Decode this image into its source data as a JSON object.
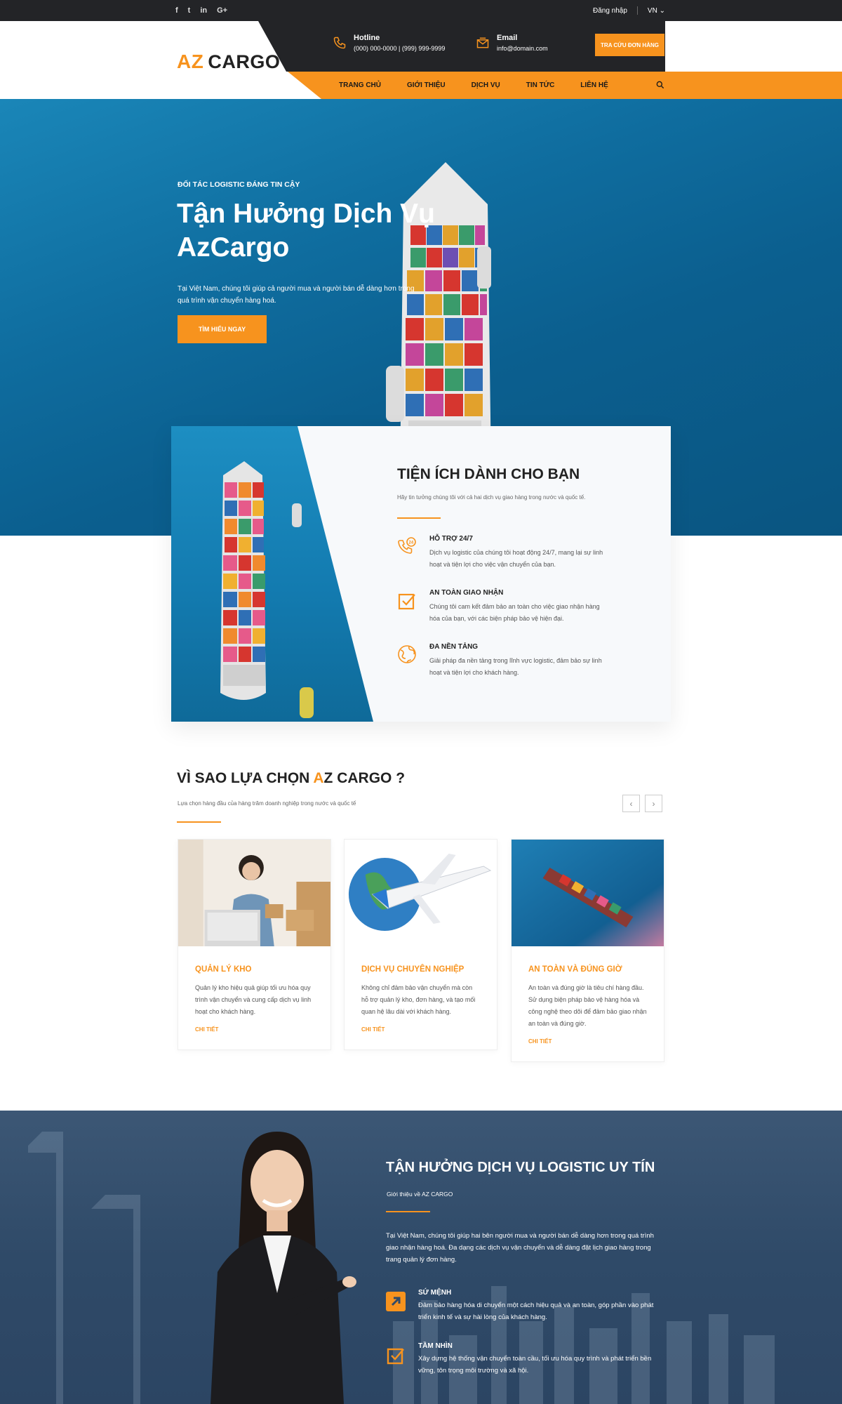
{
  "topbar": {
    "social": [
      {
        "icon": "facebook-icon",
        "glyph": "f"
      },
      {
        "icon": "twitter-icon",
        "glyph": "t"
      },
      {
        "icon": "linkedin-icon",
        "glyph": "in"
      },
      {
        "icon": "googleplus-icon",
        "glyph": "G+"
      }
    ],
    "login": "Đăng nhập",
    "language": "VN"
  },
  "header": {
    "logo_az": "AZ",
    "logo_cargo": "CARGO",
    "hotline_label": "Hotline",
    "hotline_value": "(000) 000-0000 | (999) 999-9999",
    "email_label": "Email",
    "email_value": "info@domain.com",
    "track_button": "TRA CỨU ĐƠN HÀNG",
    "nav": [
      "TRANG CHỦ",
      "GIỚI THIỆU",
      "DỊCH VỤ",
      "TIN TỨC",
      "LIÊN HỆ"
    ]
  },
  "hero": {
    "kicker": "ĐỐI TÁC LOGISTIC ĐÁNG TIN CẬY",
    "title": "Tận Hưởng Dịch Vụ AzCargo",
    "description": "Tại Việt Nam, chúng tôi giúp cả người mua và người bán dễ dàng hơn trong quá trình vận chuyển hàng hoá.",
    "button": "TÌM HIỂU NGAY"
  },
  "benefits": {
    "title": "TIỆN ÍCH DÀNH CHO BẠN",
    "subtitle": "Hãy tin tưởng chúng tôi với cả hai dịch vụ giao hàng trong nước và quốc tế.",
    "items": [
      {
        "icon": "phone-24-icon",
        "title": "HỖ TRỢ 24/7",
        "desc": "Dịch vụ logistic của chúng tôi hoạt động 24/7, mang lại sự linh hoạt và tiện lợi cho việc vận chuyển của bạn."
      },
      {
        "icon": "checkbox-icon",
        "title": "AN TOÀN GIAO NHẬN",
        "desc": "Chúng tôi cam kết đảm bảo an toàn cho việc giao nhận hàng hóa của bạn, với các biện pháp bảo vệ hiện đại."
      },
      {
        "icon": "globe-icon",
        "title": "ĐA NỀN TẢNG",
        "desc": "Giải pháp đa nền tảng trong lĩnh vực logistic, đảm bảo sự linh hoạt và tiện lợi cho khách hàng."
      }
    ]
  },
  "why": {
    "title_before": "VÌ SAO LỰA CHỌN ",
    "title_accent": "A",
    "title_after": "Z CARGO ?",
    "subtitle": "Lựa chọn hàng đầu của hàng trăm doanh nghiệp trong nước và quốc tế",
    "prev": "‹",
    "next": "›",
    "cards": [
      {
        "title": "QUẢN LÝ KHO",
        "desc": "Quản lý kho hiệu quả giúp tối ưu hóa quy trình vận chuyển và cung cấp dịch vụ linh hoạt cho khách hàng.",
        "link": "CHI TIẾT"
      },
      {
        "title": "DỊCH VỤ CHUYÊN NGHIỆP",
        "desc": "Không chỉ đảm bảo vận chuyển mà còn hỗ trợ quản lý kho, đơn hàng, và tạo mối quan hệ lâu dài với khách hàng.",
        "link": "CHI TIẾT"
      },
      {
        "title": "AN TOÀN VÀ ĐÚNG GIỜ",
        "desc": "An toàn và đúng giờ là tiêu chí hàng đầu. Sử dụng biện pháp bảo vệ hàng hóa và công nghệ theo dõi để đảm bảo giao nhận an toàn và đúng giờ.",
        "link": "CHI TIẾT"
      }
    ]
  },
  "about": {
    "title": "TẬN HƯỞNG DỊCH VỤ LOGISTIC UY TÍN",
    "subtitle": "Giới thiệu về AZ CARGO",
    "description": "Tại Việt Nam, chúng tôi giúp hai bên người mua và người bán dễ dàng hơn trong quá trình giao nhận hàng hoá. Đa dạng các dịch vụ vận chuyển và dễ dàng đặt lịch giao hàng trong trang quản lý đơn hàng.",
    "items": [
      {
        "icon": "arrow-up-right-icon",
        "title": "SỨ MỆNH",
        "desc": "Đảm bảo hàng hóa di chuyển một cách hiệu quả và an toàn, góp phần vào phát triển kinh tế và sự hài lòng của khách hàng."
      },
      {
        "icon": "checkbox-icon",
        "title": "TẦM NHÌN",
        "desc": "Xây dựng hệ thống vận chuyển toàn cầu, tối ưu hóa quy trình và phát triển bền vững, tôn trọng môi trường và xã hội."
      }
    ]
  },
  "colors": {
    "accent": "#f7931e",
    "dark": "#232427",
    "navy": "#2f4a68"
  }
}
